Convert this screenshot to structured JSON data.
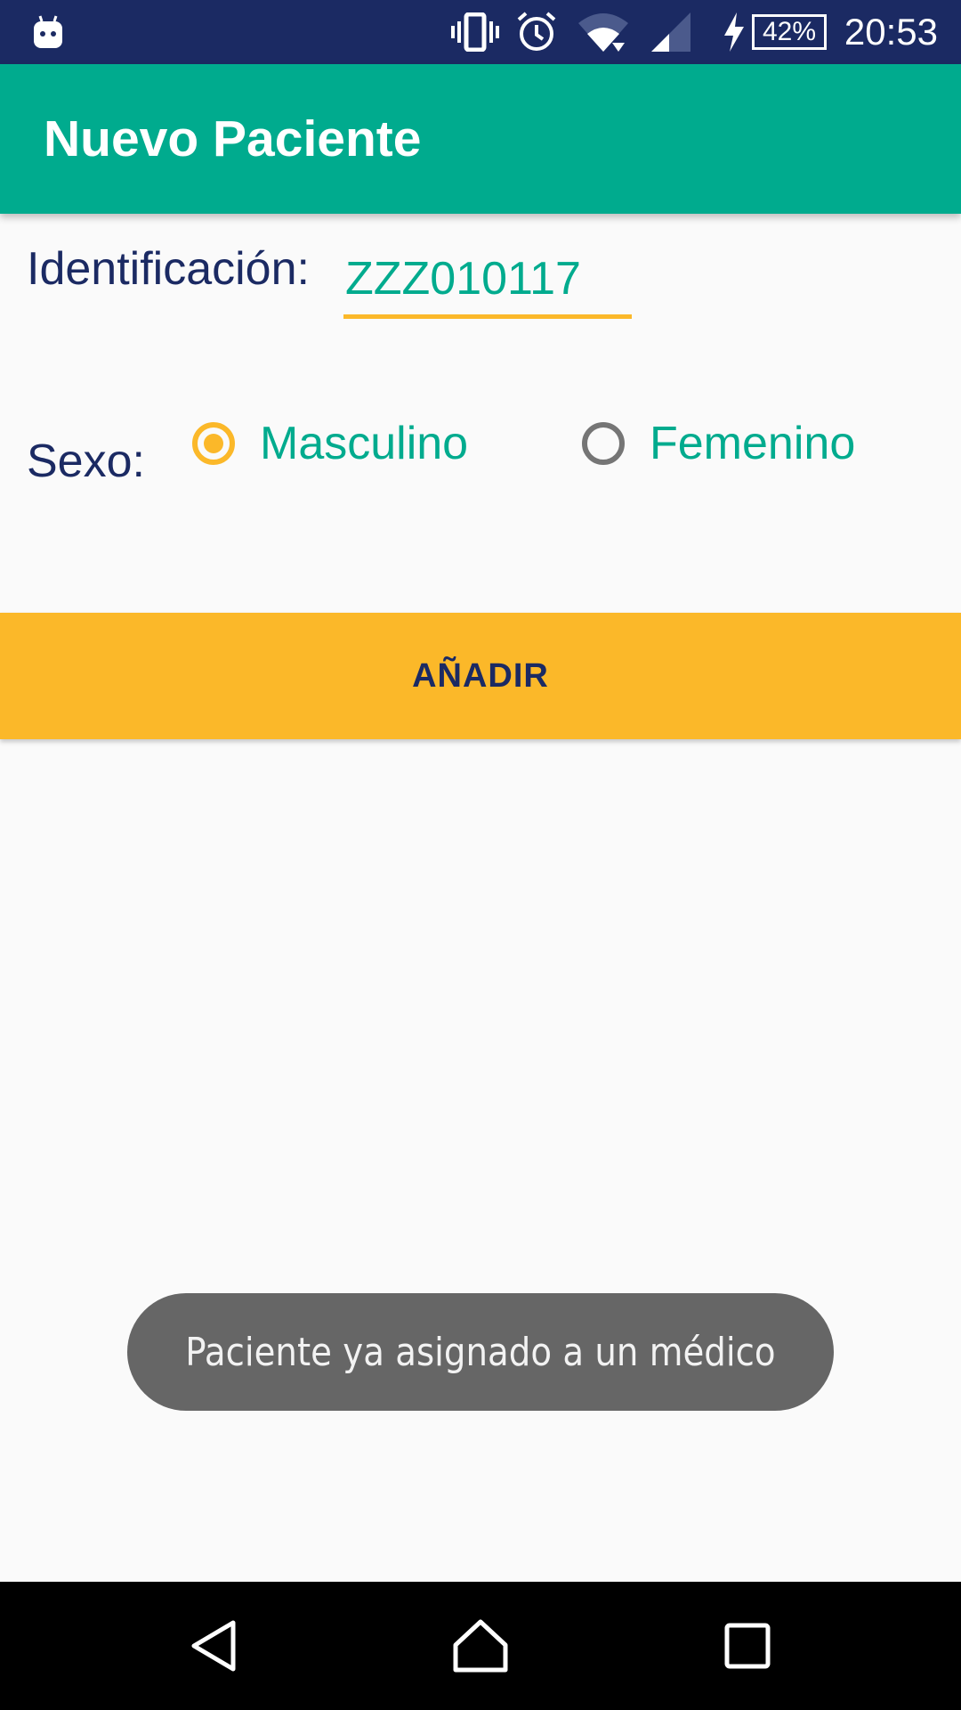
{
  "status_bar": {
    "battery_percent": "42%",
    "time": "20:53",
    "icons": [
      "android-notification-icon",
      "vibrate-icon",
      "alarm-icon",
      "wifi-icon",
      "cell-signal-icon",
      "charging-icon",
      "battery-icon"
    ]
  },
  "app_bar": {
    "title": "Nuevo Paciente"
  },
  "form": {
    "id_label": "Identificación:",
    "id_value": "ZZZ010117",
    "sex_label": "Sexo:",
    "options": [
      {
        "label": "Masculino",
        "checked": true
      },
      {
        "label": "Femenino",
        "checked": false
      }
    ]
  },
  "add_button": {
    "label": "AÑADIR"
  },
  "toast": {
    "message": "Paciente ya asignado a un médico"
  },
  "nav_bar": {
    "icons": [
      "back-icon",
      "home-icon",
      "recents-icon"
    ]
  },
  "colors": {
    "primary_dark": "#1b2a63",
    "primary": "#00ab8e",
    "accent": "#fbb829",
    "background": "#fafafa",
    "toast": "#666666"
  }
}
